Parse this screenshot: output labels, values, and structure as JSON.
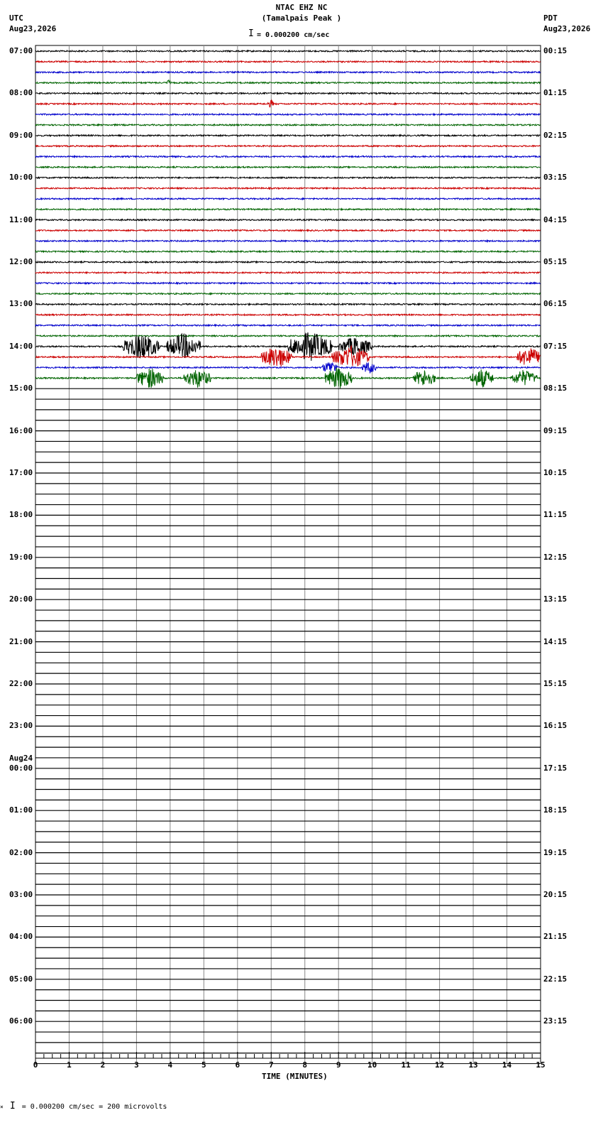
{
  "header": {
    "station": "NTAC EHZ NC",
    "location": "(Tamalpais Peak )",
    "scale": "= 0.000200 cm/sec",
    "left_tz": "UTC",
    "left_date": "Aug23,2026",
    "right_tz": "PDT",
    "right_date": "Aug23,2026"
  },
  "footer": {
    "scale_note": "= 0.000200 cm/sec =     200 microvolts"
  },
  "chart_data": {
    "type": "line",
    "title": "NTAC EHZ NC (Tamalpais Peak )",
    "xlabel": "TIME (MINUTES)",
    "xlim": [
      0,
      15
    ],
    "x_ticks": [
      "0",
      "1",
      "2",
      "3",
      "4",
      "5",
      "6",
      "7",
      "8",
      "9",
      "10",
      "11",
      "12",
      "13",
      "14",
      "15"
    ],
    "utc_hour_labels": [
      "07:00",
      "08:00",
      "09:00",
      "10:00",
      "11:00",
      "12:00",
      "13:00",
      "14:00",
      "15:00",
      "16:00",
      "17:00",
      "18:00",
      "19:00",
      "20:00",
      "21:00",
      "22:00",
      "23:00",
      "00:00",
      "01:00",
      "02:00",
      "03:00",
      "04:00",
      "05:00",
      "06:00"
    ],
    "date_change_label": "Aug24",
    "pdt_hour_labels": [
      "00:15",
      "01:15",
      "02:15",
      "03:15",
      "04:15",
      "05:15",
      "06:15",
      "07:15",
      "08:15",
      "09:15",
      "10:15",
      "11:15",
      "12:15",
      "13:15",
      "14:15",
      "15:15",
      "16:15",
      "17:15",
      "18:15",
      "19:15",
      "20:15",
      "21:15",
      "22:15",
      "23:15"
    ],
    "trace_colors": [
      "#000000",
      "#cc0000",
      "#0000cc",
      "#006400"
    ],
    "traces_per_hour": 4,
    "trace_minutes": 15,
    "recorded_traces": 32,
    "events": [
      {
        "trace": 5,
        "start_min": 6.9,
        "end_min": 7.1,
        "amplitude": 0.5
      },
      {
        "trace": 3,
        "start_min": 3.9,
        "end_min": 4.0,
        "amplitude": 0.5
      },
      {
        "trace": 28,
        "start_min": 2.6,
        "end_min": 3.7,
        "amplitude": 1.6
      },
      {
        "trace": 28,
        "start_min": 3.9,
        "end_min": 4.9,
        "amplitude": 1.6
      },
      {
        "trace": 28,
        "start_min": 7.5,
        "end_min": 8.8,
        "amplitude": 1.8
      },
      {
        "trace": 28,
        "start_min": 9.0,
        "end_min": 10.0,
        "amplitude": 1.2
      },
      {
        "trace": 29,
        "start_min": 6.7,
        "end_min": 7.6,
        "amplitude": 1.4
      },
      {
        "trace": 29,
        "start_min": 8.8,
        "end_min": 9.9,
        "amplitude": 1.4
      },
      {
        "trace": 29,
        "start_min": 14.3,
        "end_min": 15.0,
        "amplitude": 1.3
      },
      {
        "trace": 30,
        "start_min": 8.5,
        "end_min": 9.0,
        "amplitude": 0.8
      },
      {
        "trace": 30,
        "start_min": 9.7,
        "end_min": 10.1,
        "amplitude": 0.8
      },
      {
        "trace": 31,
        "start_min": 3.0,
        "end_min": 3.8,
        "amplitude": 1.3
      },
      {
        "trace": 31,
        "start_min": 4.4,
        "end_min": 5.2,
        "amplitude": 1.2
      },
      {
        "trace": 31,
        "start_min": 8.6,
        "end_min": 9.4,
        "amplitude": 1.4
      },
      {
        "trace": 31,
        "start_min": 11.2,
        "end_min": 11.9,
        "amplitude": 1.1
      },
      {
        "trace": 31,
        "start_min": 12.9,
        "end_min": 13.6,
        "amplitude": 1.2
      },
      {
        "trace": 31,
        "start_min": 14.1,
        "end_min": 14.9,
        "amplitude": 1.0
      }
    ]
  }
}
